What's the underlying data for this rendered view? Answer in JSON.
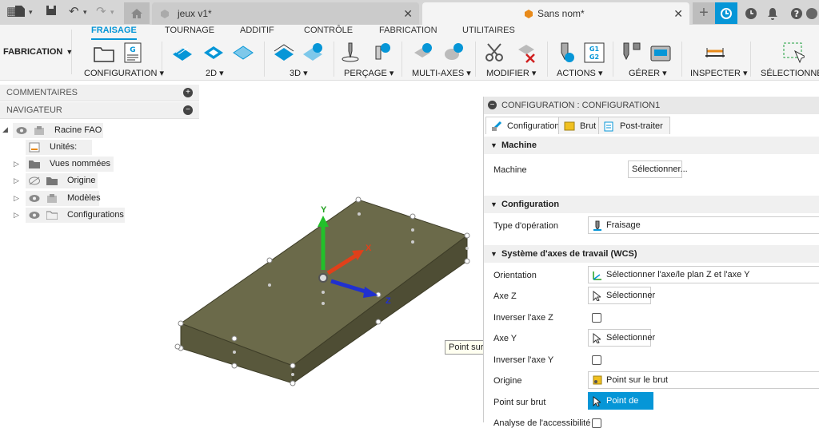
{
  "tabs": [
    {
      "label": "jeux v1*"
    },
    {
      "label": "Sans nom*"
    }
  ],
  "workspace_button": "FABRICATION",
  "ribbon_tabs": [
    "FRAISAGE",
    "TOURNAGE",
    "ADDITIF",
    "CONTRÔLE",
    "FABRICATION",
    "UTILITAIRES"
  ],
  "ribbon_groups": [
    "CONFIGURATION",
    "2D",
    "3D",
    "PERÇAGE",
    "MULTI-AXES",
    "MODIFIER",
    "ACTIONS",
    "GÉRER",
    "INSPECTER",
    "SÉLECTIONNER"
  ],
  "panels": {
    "comments": "COMMENTAIRES",
    "navigator": "NAVIGATEUR"
  },
  "tree": [
    {
      "label": "Racine FAO"
    },
    {
      "label": "Unités: mm"
    },
    {
      "label": "Vues nommées"
    },
    {
      "label": "Origine"
    },
    {
      "label": "Modèles"
    },
    {
      "label": "Configurations"
    }
  ],
  "viewport": {
    "tooltip": "Point sur brut",
    "axes": [
      "Y",
      "X",
      "Z"
    ]
  },
  "config": {
    "title": "CONFIGURATION : CONFIGURATION1",
    "tabs": [
      "Configuration",
      "Brut",
      "Post-traiter"
    ],
    "sections": {
      "machine": "Machine",
      "configuration": "Configuration",
      "wcs": "Système d'axes de travail (WCS)"
    },
    "machine_label": "Machine",
    "machine_button": "Sélectionner...",
    "op_type_label": "Type d'opération",
    "op_type_value": "Fraisage",
    "orientation_label": "Orientation",
    "orientation_value": "Sélectionner l'axe/le plan Z et l'axe Y",
    "axis_z_label": "Axe Z",
    "axis_z_button": "Sélectionner",
    "invert_z_label": "Inverser l'axe Z",
    "axis_y_label": "Axe Y",
    "axis_y_button": "Sélectionner",
    "invert_y_label": "Inverser l'axe Y",
    "origin_label": "Origine",
    "origin_value": "Point sur le brut",
    "stock_point_label": "Point sur brut",
    "stock_point_value": "Point de bloc",
    "last_label": "Analyse de l'accessibilité"
  },
  "colors": {
    "accent": "#0696d7",
    "stock": "#6b6a4a",
    "y_axis": "#22c02a",
    "x_axis": "#e0401a",
    "z_axis": "#2030d0"
  }
}
